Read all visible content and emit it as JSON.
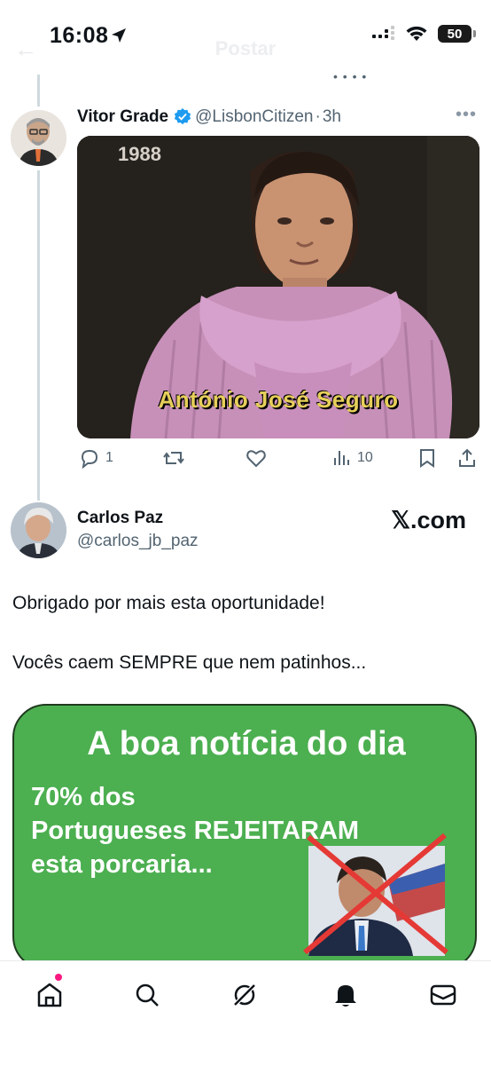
{
  "status_bar": {
    "time": "16:08",
    "battery": "50"
  },
  "faded_header": {
    "title": "Postar"
  },
  "quoted_tweet": {
    "author_name": "Vitor Grade",
    "author_handle": "@LisbonCitizen",
    "separator": "·",
    "time_ago": "3h",
    "media": {
      "year_label": "1988",
      "caption": "António José Seguro"
    },
    "actions": {
      "reply_count": "1",
      "views_count": "10"
    }
  },
  "post": {
    "author_name": "Carlos Paz",
    "author_handle": "@carlos_jb_paz",
    "watermark": "𝕏.com",
    "text_line_1": "Obrigado por mais esta oportunidade!",
    "text_line_2": "Vocês caem SEMPRE que nem patinhos...",
    "card": {
      "title": "A boa notícia do dia",
      "line_1": "70% dos",
      "line_2": "Portugueses REJEITARAM",
      "line_3": "esta porcaria..."
    }
  },
  "tab_bar": {
    "items": [
      "home-icon",
      "search-icon",
      "grok-icon",
      "notifications-icon",
      "messages-icon"
    ]
  },
  "colors": {
    "accent": "#1d9bf0",
    "notification_dot": "#f91880",
    "card_green": "#4caf50",
    "cross_red": "#e53935"
  }
}
